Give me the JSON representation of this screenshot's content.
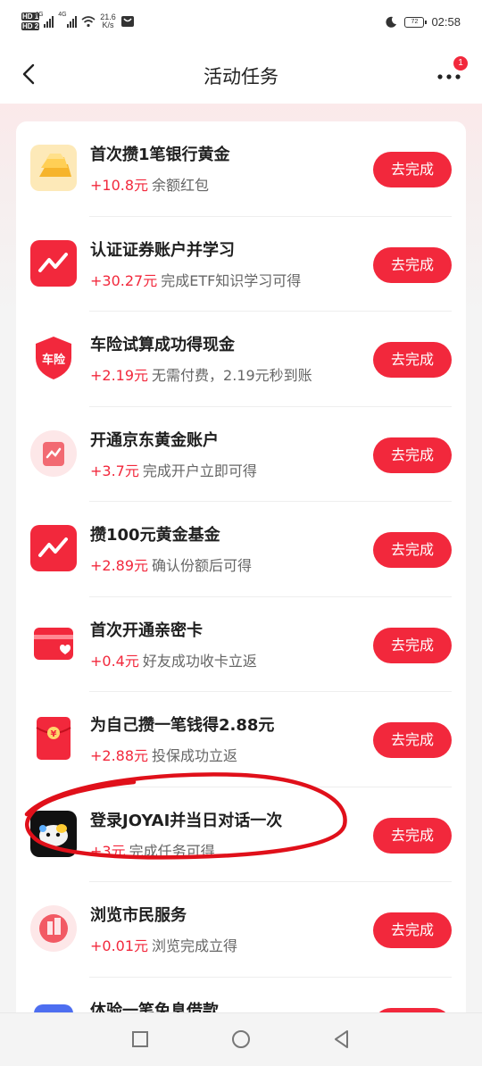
{
  "status": {
    "left_badges": [
      "HD 1",
      "HD 2"
    ],
    "signal1": "4G",
    "signal2": "4G",
    "speed_value": "21.6",
    "speed_unit": "K/s",
    "battery": "72",
    "time": "02:58"
  },
  "nav": {
    "title": "活动任务",
    "more_badge": "1"
  },
  "tasks": [
    {
      "title": "首次攒1笔银行黄金",
      "reward": "+10.8元",
      "desc": "余额红包",
      "button": "去完成",
      "icon": "gold-bar-icon"
    },
    {
      "title": "认证证券账户并学习",
      "reward": "+30.27元",
      "desc": "完成ETF知识学习可得",
      "button": "去完成",
      "icon": "stock-chart-icon"
    },
    {
      "title": "车险试算成功得现金",
      "reward": "+2.19元",
      "desc": "无需付费，2.19元秒到账",
      "button": "去完成",
      "icon": "car-insurance-shield-icon",
      "icon_text": "车险"
    },
    {
      "title": "开通京东黄金账户",
      "reward": "+3.7元",
      "desc": "完成开户立即可得",
      "button": "去完成",
      "icon": "gold-account-icon"
    },
    {
      "title": "攒100元黄金基金",
      "reward": "+2.89元",
      "desc": "确认份额后可得",
      "button": "去完成",
      "icon": "fund-chart-icon"
    },
    {
      "title": "首次开通亲密卡",
      "reward": "+0.4元",
      "desc": "好友成功收卡立返",
      "button": "去完成",
      "icon": "intimate-card-icon"
    },
    {
      "title": "为自己攒一笔钱得2.88元",
      "reward": "+2.88元",
      "desc": "投保成功立返",
      "button": "去完成",
      "icon": "red-envelope-icon",
      "icon_text": "¥"
    },
    {
      "title": "登录JOYAI并当日对话一次",
      "reward": "+3元",
      "desc": "完成任务可得",
      "button": "去完成",
      "icon": "joyai-app-icon"
    },
    {
      "title": "浏览市民服务",
      "reward": "+0.01元",
      "desc": "浏览完成立得",
      "button": "去完成",
      "icon": "citizen-service-icon"
    },
    {
      "title": "体验一笔免息借款",
      "reward": "",
      "desc": "",
      "button": "",
      "icon": "loan-icon"
    }
  ],
  "colors": {
    "accent": "#f2283c",
    "annotation": "#e0101a"
  }
}
